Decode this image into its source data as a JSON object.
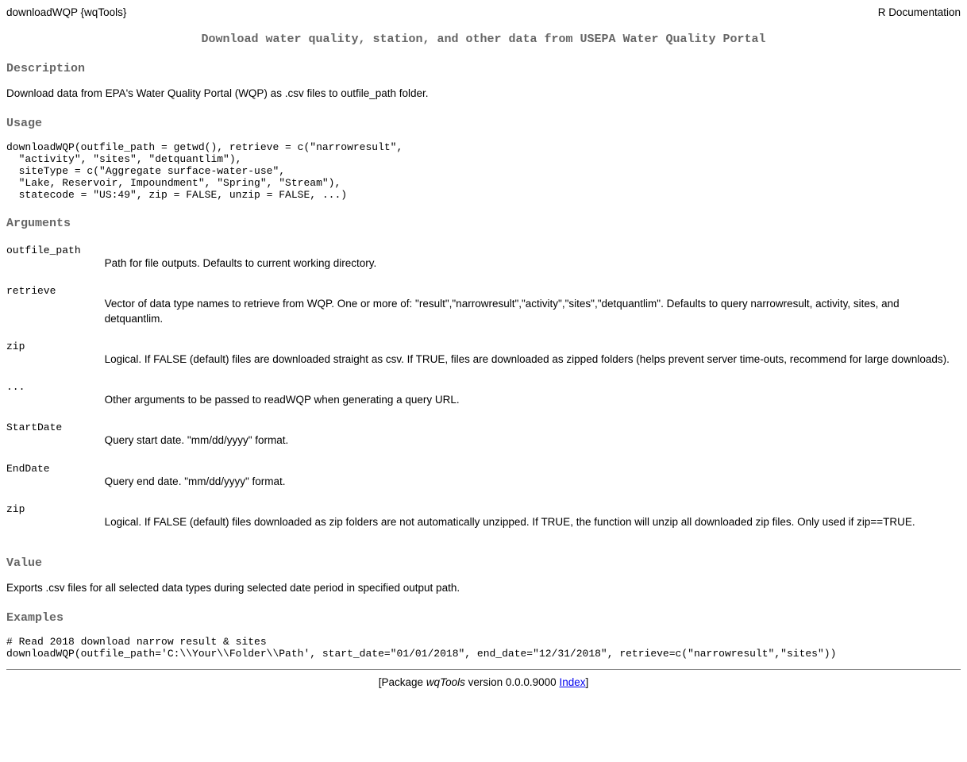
{
  "header": {
    "left": "downloadWQP {wqTools}",
    "right": "R Documentation"
  },
  "title": "Download water quality, station, and other data from USEPA Water Quality Portal",
  "sections": {
    "description_h": "Description",
    "description_p": "Download data from EPA's Water Quality Portal (WQP) as .csv files to outfile_path folder.",
    "usage_h": "Usage",
    "usage_code": "downloadWQP(outfile_path = getwd(), retrieve = c(\"narrowresult\",\n  \"activity\", \"sites\", \"detquantlim\"),\n  siteType = c(\"Aggregate surface-water-use\",\n  \"Lake, Reservoir, Impoundment\", \"Spring\", \"Stream\"),\n  statecode = \"US:49\", zip = FALSE, unzip = FALSE, ...)",
    "arguments_h": "Arguments",
    "value_h": "Value",
    "value_p": "Exports .csv files for all selected data types during selected date period in specified output path.",
    "examples_h": "Examples",
    "examples_code": "# Read 2018 download narrow result & sites\ndownloadWQP(outfile_path='C:\\\\Your\\\\Folder\\\\Path', start_date=\"01/01/2018\", end_date=\"12/31/2018\", retrieve=c(\"narrowresult\",\"sites\"))"
  },
  "arguments": [
    {
      "name": "outfile_path",
      "desc": "Path for file outputs. Defaults to current working directory."
    },
    {
      "name": "retrieve",
      "desc": "Vector of data type names to retrieve from WQP. One or more of: \"result\",\"narrowresult\",\"activity\",\"sites\",\"detquantlim\". Defaults to query narrowresult, activity, sites, and detquantlim."
    },
    {
      "name": "zip",
      "desc": "Logical. If FALSE (default) files are downloaded straight as csv. If TRUE, files are downloaded as zipped folders (helps prevent server time-outs, recommend for large downloads)."
    },
    {
      "name": "...",
      "desc": "Other arguments to be passed to readWQP when generating a query URL."
    },
    {
      "name": "StartDate",
      "desc": "Query start date. \"mm/dd/yyyy\" format."
    },
    {
      "name": "EndDate",
      "desc": "Query end date. \"mm/dd/yyyy\" format."
    },
    {
      "name": "zip",
      "desc": "Logical. If FALSE (default) files downloaded as zip folders are not automatically unzipped. If TRUE, the function will unzip all downloaded zip files. Only used if zip==TRUE."
    }
  ],
  "footer": {
    "prefix": "[Package ",
    "pkg": "wqTools",
    "mid": " version 0.0.0.9000 ",
    "link": "Index",
    "suffix": "]"
  }
}
